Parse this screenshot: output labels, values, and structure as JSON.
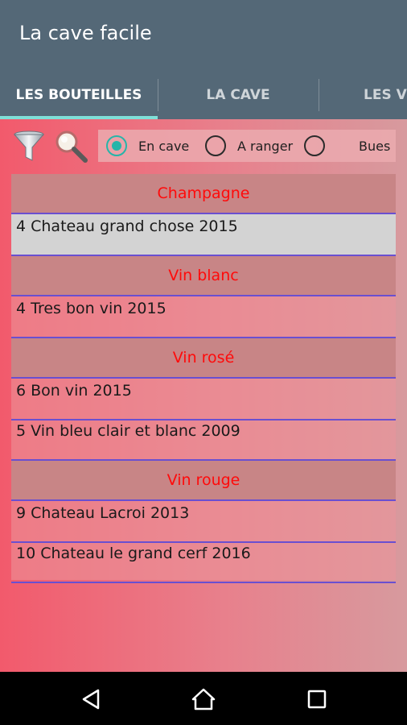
{
  "app": {
    "title": "La cave facile"
  },
  "tabs": [
    {
      "label": "LES BOUTEILLES",
      "active": true
    },
    {
      "label": "LA CAVE",
      "active": false
    },
    {
      "label": "LES VI",
      "active": false
    }
  ],
  "toolbar": {
    "filter_icon": "funnel-icon",
    "search_icon": "magnifier-icon"
  },
  "filter_options": [
    {
      "label": "En cave",
      "checked": true
    },
    {
      "label": "A ranger",
      "checked": false
    },
    {
      "label": "Bues",
      "checked": false
    }
  ],
  "sections": [
    {
      "title": "Champagne",
      "items": [
        "4 Chateau grand chose 2015"
      ]
    },
    {
      "title": "Vin blanc",
      "items": [
        "4 Tres bon vin 2015"
      ]
    },
    {
      "title": "Vin rosé",
      "items": [
        "6 Bon vin 2015",
        "5 Vin bleu clair et blanc  2009"
      ]
    },
    {
      "title": "Vin rouge",
      "items": [
        "9 Chateau Lacroi 2013",
        "10 Chateau le grand cerf  2016"
      ]
    }
  ],
  "colors": {
    "app_bar": "#546877",
    "accent": "#26b5a9",
    "section_title": "#ff0a0a",
    "divider": "#6a4fd0"
  },
  "nav": {
    "back_icon": "back-triangle-icon",
    "home_icon": "home-icon",
    "recents_icon": "recents-square-icon"
  }
}
